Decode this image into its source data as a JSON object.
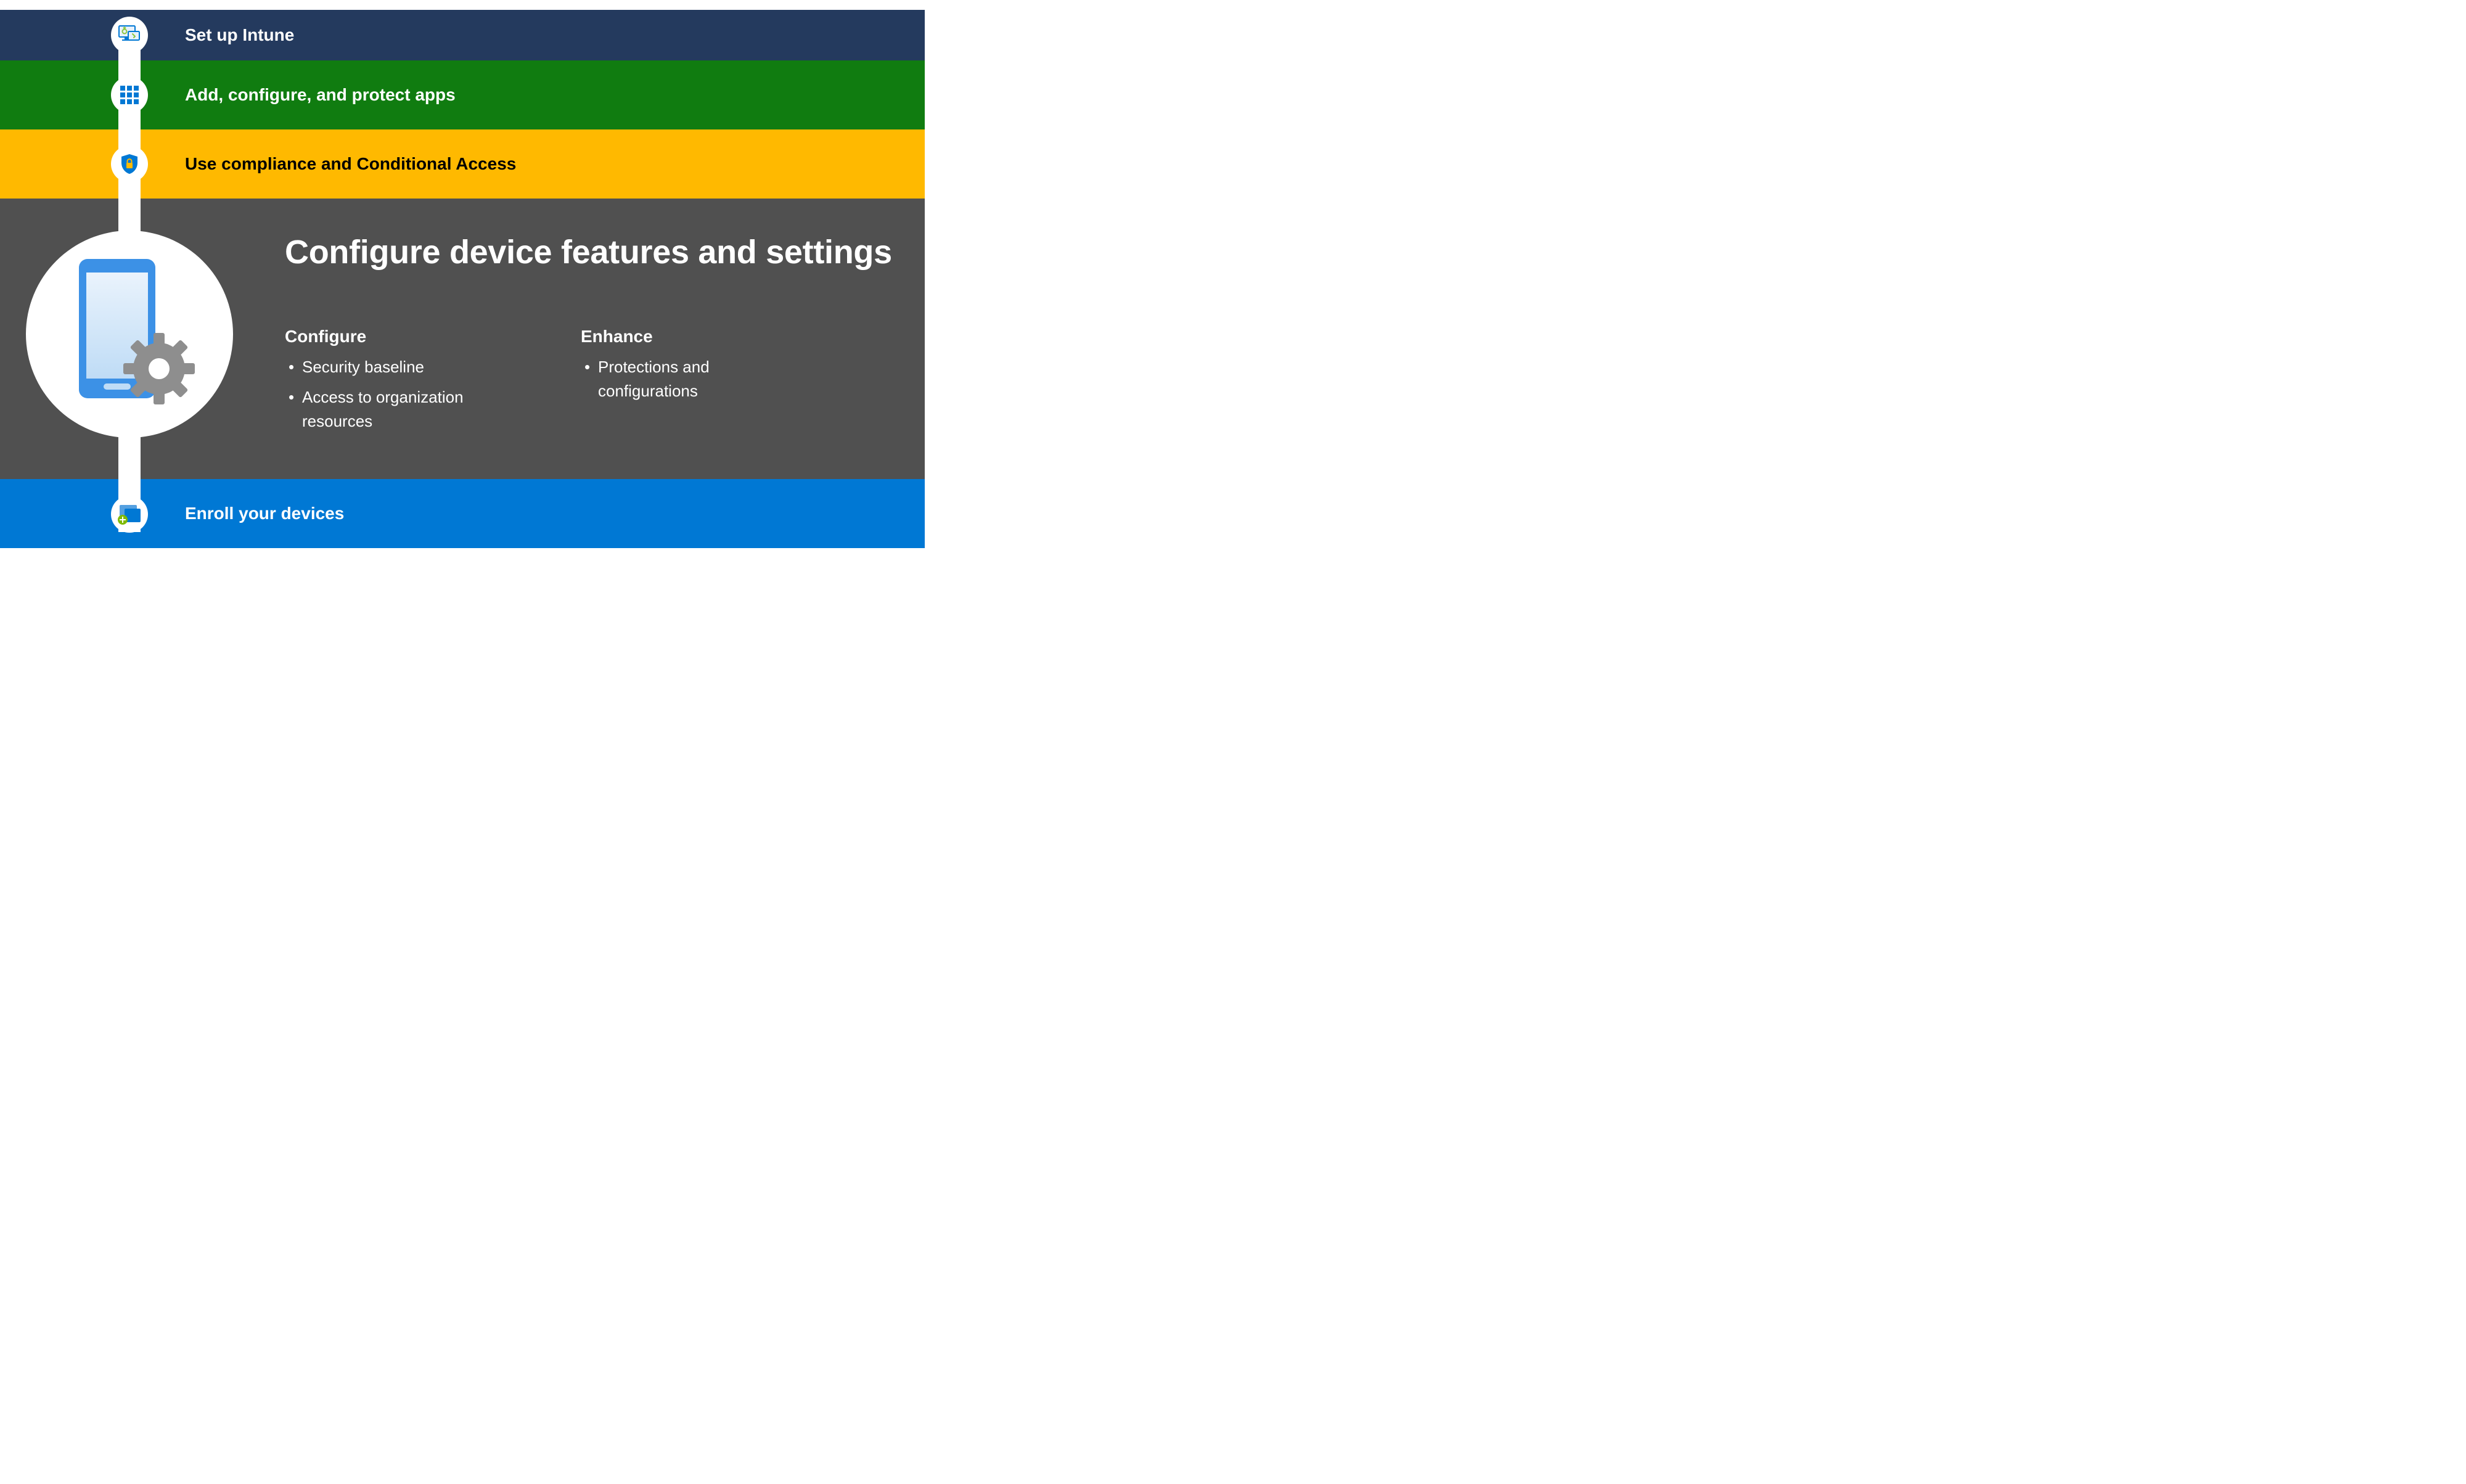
{
  "steps": {
    "step1": {
      "label": "Set up Intune",
      "bg": "#243A5E",
      "icon": "monitor-icon"
    },
    "step2": {
      "label": "Add, configure, and protect apps",
      "bg": "#107C10",
      "icon": "apps-grid-icon"
    },
    "step3": {
      "label": "Use compliance and Conditional Access",
      "bg": "#FFB900",
      "icon": "shield-lock-icon"
    },
    "step4": {
      "title": "Configure device features and settings",
      "bg": "#505050",
      "columns": {
        "colA": {
          "heading": "Configure",
          "items": [
            "Security baseline",
            "Access to organization resources"
          ]
        },
        "colB": {
          "heading": "Enhance",
          "items": [
            "Protections and configurations"
          ]
        }
      },
      "icon": "device-gear-icon"
    },
    "step5": {
      "label": "Enroll your devices",
      "bg": "#0078D4",
      "icon": "enroll-devices-icon"
    }
  },
  "colors": {
    "blue": "#0078D4",
    "lightBlue": "#50A0E0",
    "gearGrey": "#909090",
    "offWhite": "#FFFFFF"
  }
}
